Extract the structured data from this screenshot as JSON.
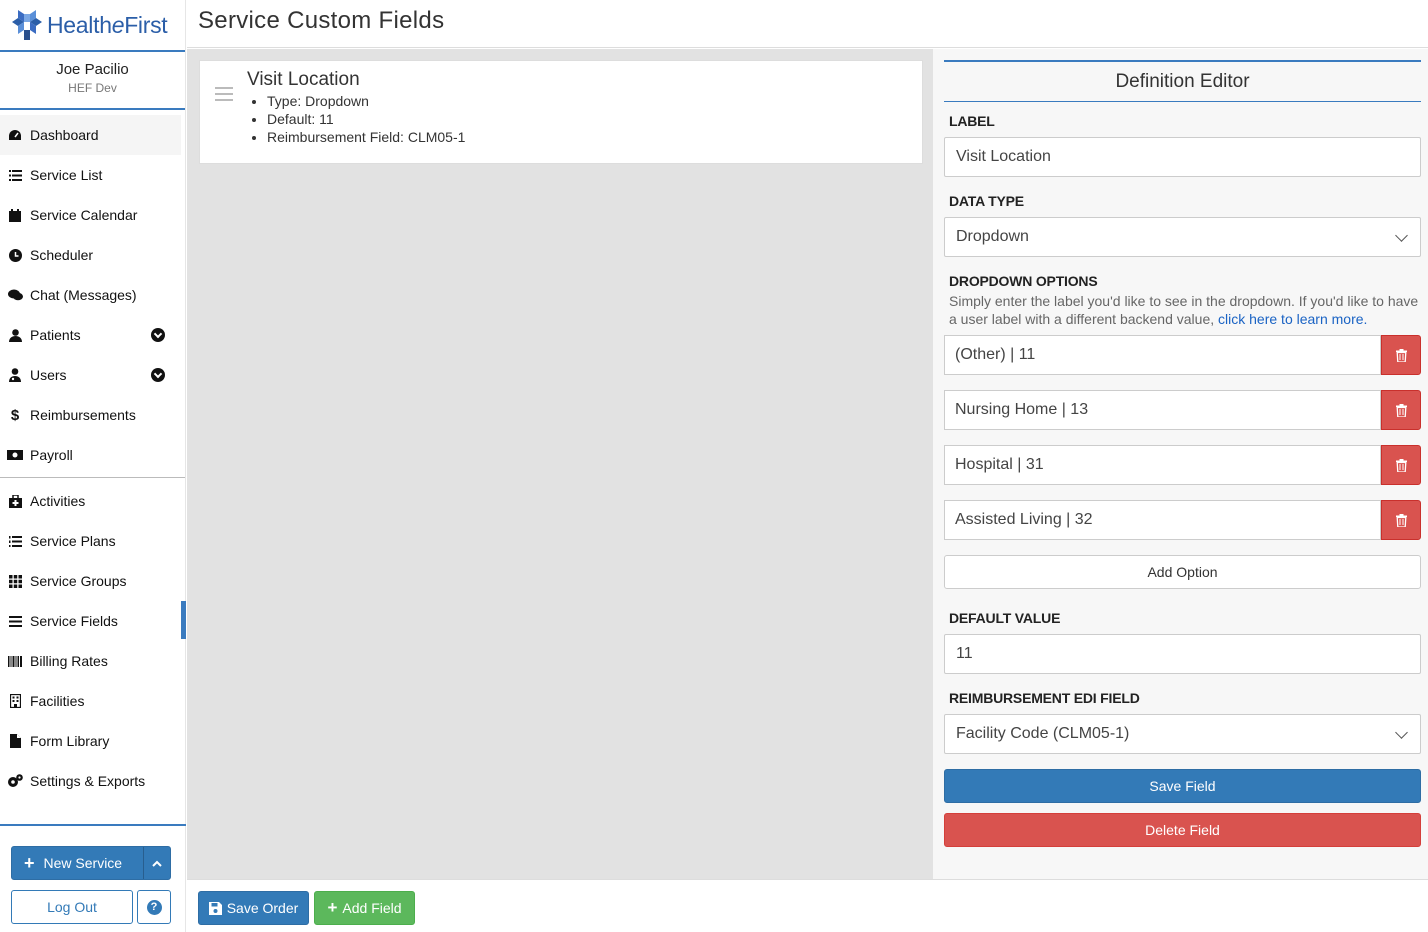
{
  "app": {
    "brand_prefix": "Health",
    "brand_italic": "e",
    "brand_suffix": "First"
  },
  "user": {
    "name": "Joe Pacilio",
    "org": "HEF Dev"
  },
  "sidebar": {
    "items": [
      {
        "label": "Dashboard",
        "icon": "tachometer-icon"
      },
      {
        "label": "Service List",
        "icon": "list-icon"
      },
      {
        "label": "Service Calendar",
        "icon": "calendar-icon"
      },
      {
        "label": "Scheduler",
        "icon": "clock-icon"
      },
      {
        "label": "Chat (Messages)",
        "icon": "comments-icon"
      },
      {
        "label": "Patients",
        "icon": "user-icon"
      },
      {
        "label": "Users",
        "icon": "user-md-icon"
      },
      {
        "label": "Reimbursements",
        "icon": "dollar-icon"
      },
      {
        "label": "Payroll",
        "icon": "money-icon"
      }
    ],
    "items2": [
      {
        "label": "Activities",
        "icon": "medkit-icon"
      },
      {
        "label": "Service Plans",
        "icon": "list-ol-icon"
      },
      {
        "label": "Service Groups",
        "icon": "grid-icon"
      },
      {
        "label": "Service Fields",
        "icon": "bars-icon"
      },
      {
        "label": "Billing Rates",
        "icon": "barcode-icon"
      },
      {
        "label": "Facilities",
        "icon": "building-icon"
      },
      {
        "label": "Form Library",
        "icon": "file-icon"
      },
      {
        "label": "Settings & Exports",
        "icon": "cogs-icon"
      }
    ],
    "new_service": "New Service",
    "logout": "Log Out",
    "help_glyph": "?"
  },
  "header": {
    "title": "Service Custom Fields"
  },
  "field_card": {
    "title": "Visit Location",
    "details": [
      "Type: Dropdown",
      "Default: 11",
      "Reimbursement Field: CLM05-1"
    ]
  },
  "editor": {
    "title": "Definition Editor",
    "label_heading": "LABEL",
    "label_value": "Visit Location",
    "data_type_heading": "DATA TYPE",
    "data_type_value": "Dropdown",
    "dropdown_heading": "DROPDOWN OPTIONS",
    "help_text": "Simply enter the label you'd like to see in the dropdown. If you'd like to have a user label with a different backend value, ",
    "help_link": "click here to learn more.",
    "options": [
      "(Other) | 11",
      "Nursing Home | 13",
      "Hospital | 31",
      "Assisted Living | 32"
    ],
    "add_option": "Add Option",
    "default_heading": "DEFAULT VALUE",
    "default_value": "11",
    "edi_heading": "REIMBURSEMENT EDI FIELD",
    "edi_value": "Facility Code (CLM05-1)",
    "save_field": "Save Field",
    "delete_field": "Delete Field"
  },
  "footer": {
    "save_order": "Save Order",
    "add_field": "Add Field"
  },
  "colors": {
    "primary": "#337ab7",
    "danger": "#d9534f",
    "success": "#5cb85c",
    "accent": "#3a7bbf"
  }
}
